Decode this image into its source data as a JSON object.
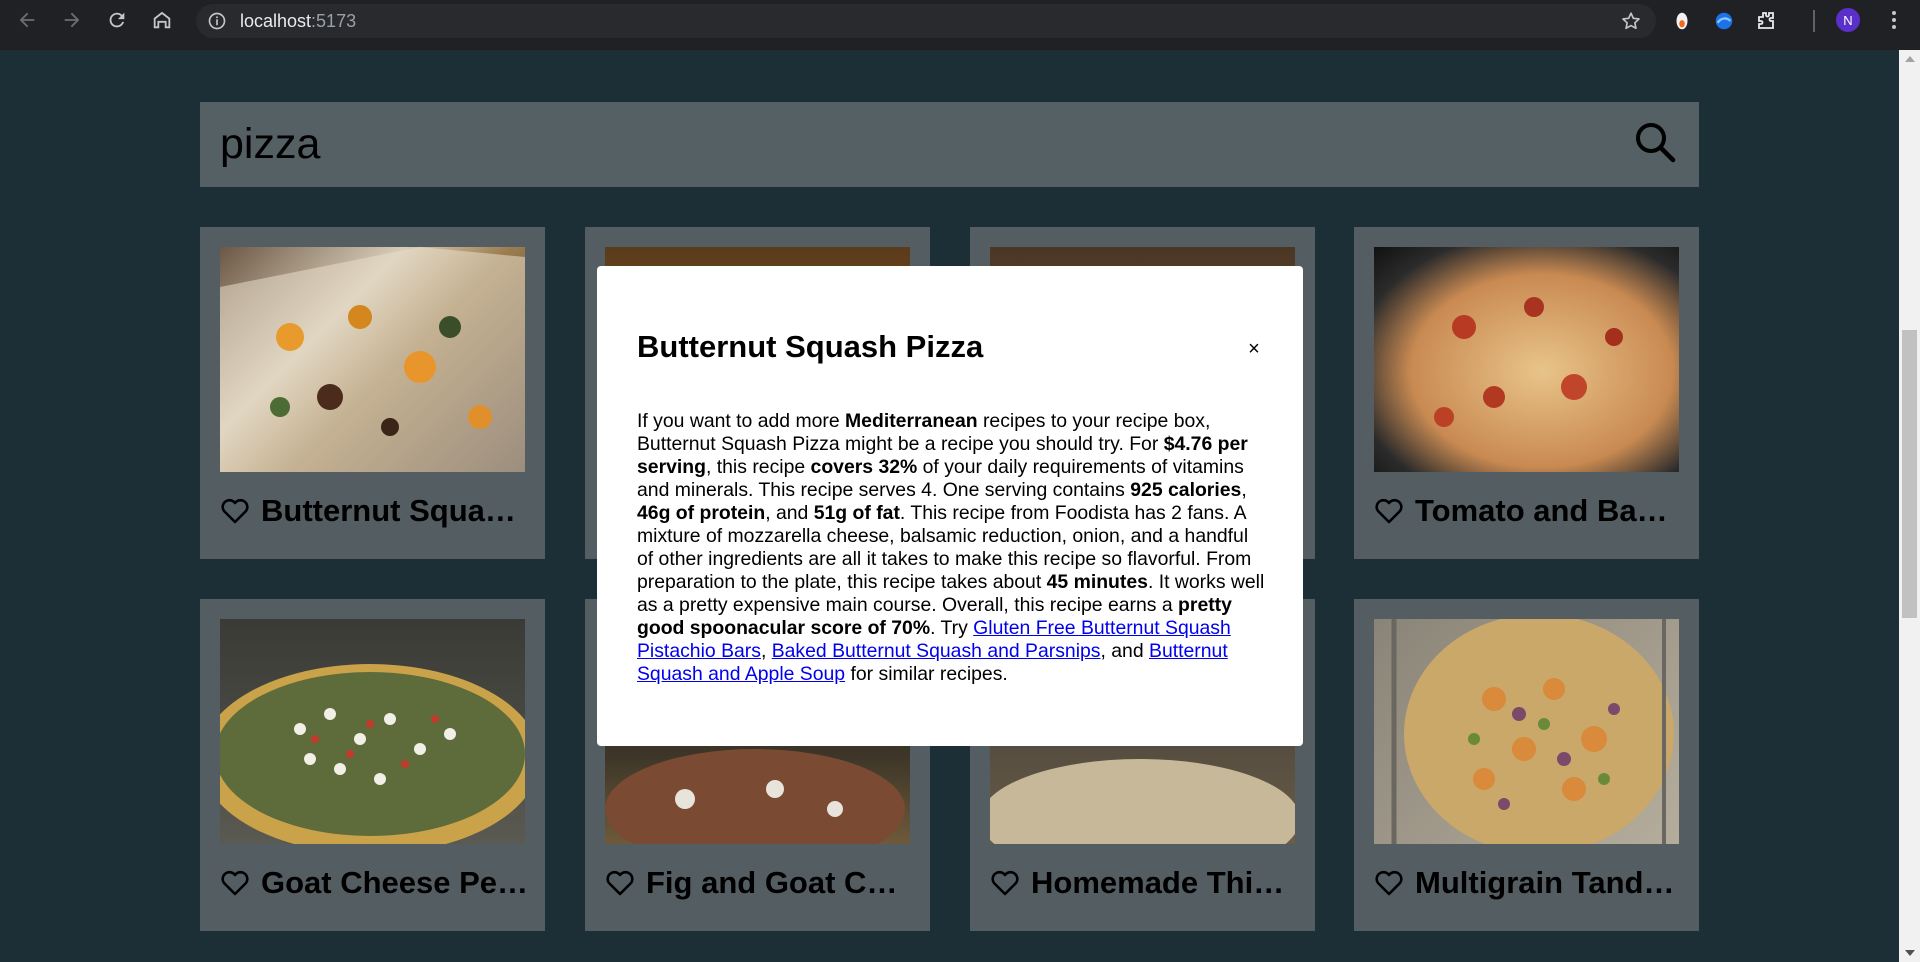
{
  "browser": {
    "url_host": "localhost",
    "url_port": ":5173",
    "avatar_letter": "N"
  },
  "search": {
    "value": "pizza"
  },
  "cards": [
    {
      "title": "Butternut Squash Pizza",
      "image": "food-photo-squash-pizza"
    },
    {
      "title": "",
      "image": "food-photo-pizza"
    },
    {
      "title": "",
      "image": "food-photo-pizza"
    },
    {
      "title": "Tomato and Bacon Pizza",
      "image": "food-photo-tomato-pizza"
    },
    {
      "title": "Goat Cheese Pesto Pizza",
      "image": "food-photo-goat-cheese-pizza"
    },
    {
      "title": "Fig and Goat Cheese Pizza",
      "image": "food-photo-fig-pizza"
    },
    {
      "title": "Homemade Thin Crust Pizza",
      "image": "food-photo-thin-crust-pizza"
    },
    {
      "title": "Multigrain Tandoori Pizza",
      "image": "food-photo-multigrain-pizza"
    }
  ],
  "modal": {
    "title": "Butternut Squash Pizza",
    "close_label": "×",
    "summary": {
      "t1": "If you want to add more ",
      "b1": "Mediterranean",
      "t2": " recipes to your recipe box, Butternut Squash Pizza might be a recipe you should try. For ",
      "b2": "$4.76 per serving",
      "t3": ", this recipe ",
      "b3": "covers 32%",
      "t4": " of your daily requirements of vitamins and minerals. This recipe serves 4. One serving contains ",
      "b4": "925 calories",
      "t5": ", ",
      "b5": "46g of protein",
      "t6": ", and ",
      "b6": "51g of fat",
      "t7": ". This recipe from Foodista has 2 fans. A mixture of mozzarella cheese, balsamic reduction, onion, and a handful of other ingredients are all it takes to make this recipe so flavorful. From preparation to the plate, this recipe takes about ",
      "b7": "45 minutes",
      "t8": ". It works well as a pretty expensive main course. Overall, this recipe earns a ",
      "b8": "pretty good spoonacular score of 70%",
      "t9": ". Try ",
      "link1": "Gluten Free Butternut Squash Pistachio Bars",
      "t10": ", ",
      "link2": "Baked Butternut Squash and Parsnips",
      "t11": ", and ",
      "link3": "Butternut Squash and Apple Soup",
      "t12": " for similar recipes."
    }
  }
}
